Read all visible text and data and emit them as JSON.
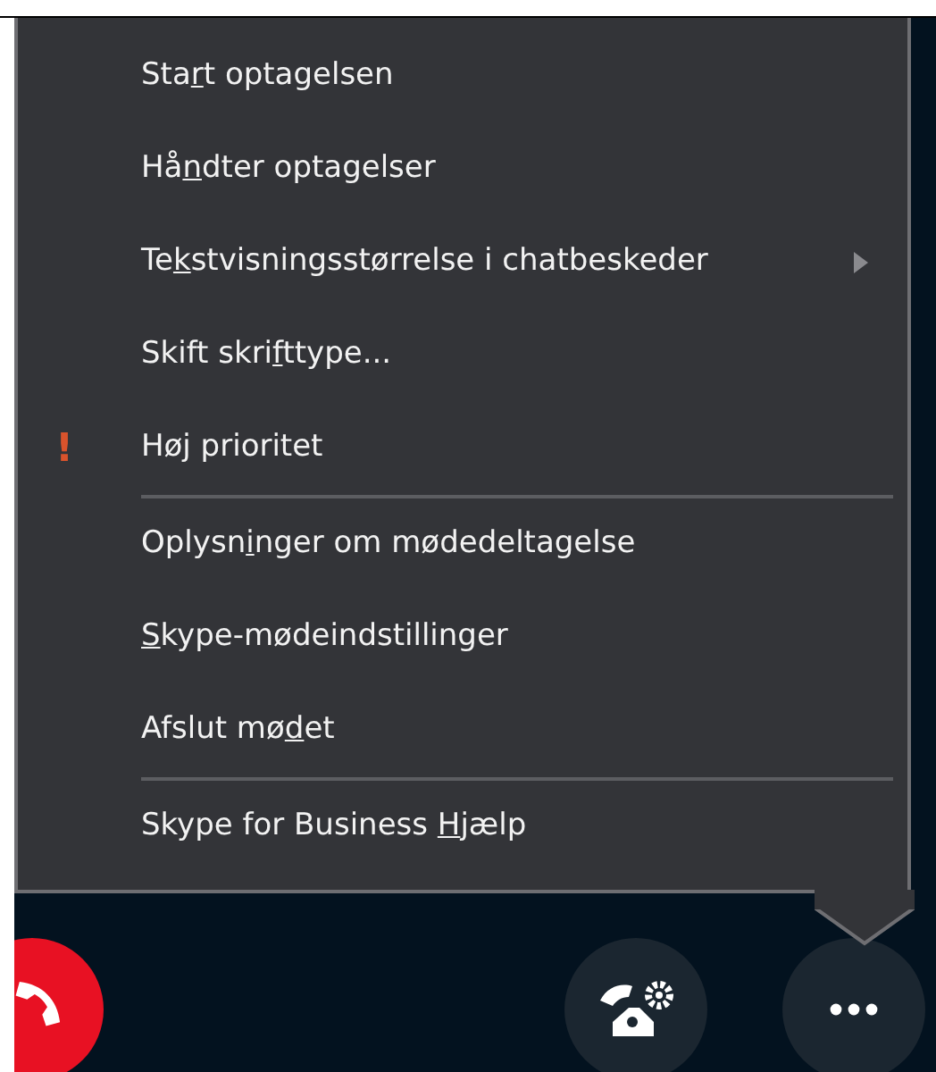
{
  "menu": {
    "items": [
      {
        "kind": "item",
        "label_before": "Sta",
        "access_key": "r",
        "label_after": "t optagelsen",
        "submenu": false
      },
      {
        "kind": "item",
        "label_before": "Hå",
        "access_key": "n",
        "label_after": "dter optagelser",
        "submenu": false
      },
      {
        "kind": "item",
        "label_before": "Te",
        "access_key": "k",
        "label_after": "stvisningsstørrelse i chatbeskeder",
        "submenu": true
      },
      {
        "kind": "item",
        "label_before": "Skift skri",
        "access_key": "f",
        "label_after": "ttype...",
        "submenu": false
      },
      {
        "kind": "item",
        "label_before": "Høj prioritet",
        "submenu": false,
        "marker": "!"
      },
      {
        "kind": "separator"
      },
      {
        "kind": "item",
        "label_before": "Oplysn",
        "access_key": "i",
        "label_after": "nger om mødedeltagelse",
        "submenu": false
      },
      {
        "kind": "item",
        "access_key": "S",
        "label_after": "kype-mødeindstillinger",
        "submenu": false
      },
      {
        "kind": "item",
        "label_before": "Afslut mø",
        "access_key": "d",
        "label_after": "et",
        "submenu": false
      },
      {
        "kind": "separator"
      },
      {
        "kind": "item",
        "label_before": "Skype for Business ",
        "access_key": "H",
        "label_after": "jælp",
        "submenu": false
      }
    ]
  },
  "call_controls": [
    {
      "kind": "hangup"
    },
    {
      "kind": "call_settings"
    },
    {
      "kind": "more"
    }
  ]
}
